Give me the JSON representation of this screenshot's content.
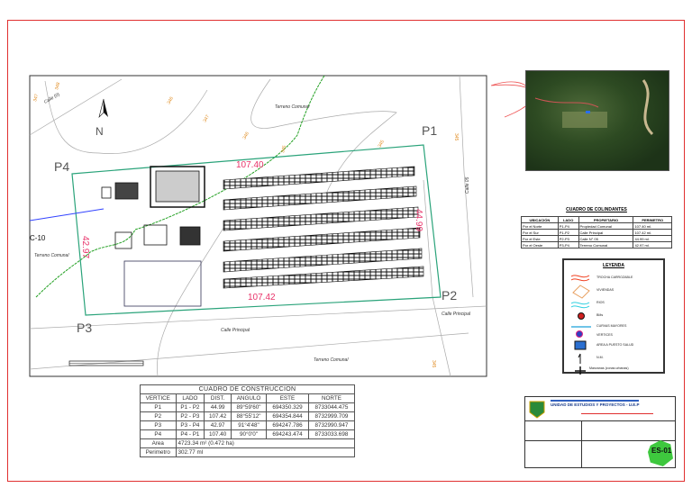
{
  "map": {
    "vertices": [
      "P1",
      "P2",
      "P3",
      "P4"
    ],
    "side_labels": {
      "north": "107.40",
      "east": "44.99",
      "south": "107.42",
      "west": "42.97"
    },
    "place_labels": [
      "Terreno Comunal",
      "Terreno Comunal",
      "Terreno Comunal",
      "Calle Principal",
      "Calle Principal",
      "Calle (0)",
      "Calle 05",
      "C-10"
    ],
    "contours": [
      "347",
      "348",
      "346",
      "347",
      "346",
      "345",
      "345",
      "345",
      "345"
    ],
    "north_letter": "N"
  },
  "construction_table": {
    "title": "CUADRO DE CONSTRUCCION",
    "headers": [
      "VERTICE",
      "LADO",
      "DIST.",
      "ANGULO",
      "ESTE",
      "NORTE"
    ],
    "rows": [
      [
        "P1",
        "P1 - P2",
        "44.99",
        "89°59'60\"",
        "694350.329",
        "8733044.475"
      ],
      [
        "P2",
        "P2 - P3",
        "107.42",
        "88°55'12\"",
        "694354.844",
        "8732999.709"
      ],
      [
        "P3",
        "P3 - P4",
        "42.97",
        "91°4'48\"",
        "694247.786",
        "8732990.947"
      ],
      [
        "P4",
        "P4 - P1",
        "107.40",
        "90°0'0\"",
        "694243.474",
        "8733033.698"
      ]
    ],
    "area_label": "Area",
    "area_value": "4723.34 m² (0.472 ha)",
    "perimeter_label": "Perimetro",
    "perimeter_value": "302.77 ml"
  },
  "boundaries_table": {
    "title": "CUADRO DE COLINDANTES",
    "headers": [
      "UBICACIÓN",
      "LADO",
      "PROPIETARIO",
      "PERIMETRO"
    ],
    "rows": [
      [
        "Por el Norte",
        "P1-P4",
        "Propiedad Comunal",
        "107.40 ml."
      ],
      [
        "Por el Sur",
        "P1-P2",
        "Calle Principal",
        "107.42 ml."
      ],
      [
        "Por el Este",
        "P2-P3",
        "Calle N° 05",
        "44.99 ml."
      ],
      [
        "Por el Oeste",
        "P3-P4",
        "Terreno Comunal",
        "42.97 ml."
      ]
    ]
  },
  "legend": {
    "title": "LEYENDA",
    "items": [
      "TROCHA CARROZABLE",
      "VIVIENDAS",
      "RIOS",
      "BMs",
      "CURVAS MAYORES",
      "VERTICES",
      "AREA A PUESTO SALUD",
      "N.M.",
      "Manzanas (zonas urbanas)"
    ]
  },
  "title_block": {
    "unit": "UNIDAD DE ESTUDIOS Y PROYECTOS - U.E.P",
    "sheet_code": "ES-01"
  },
  "colors": {
    "border": "#e03030",
    "boundary": "#2aa37a",
    "side_label": "#e8336a",
    "contour": "#e08a1e",
    "trail": "#22a022"
  }
}
